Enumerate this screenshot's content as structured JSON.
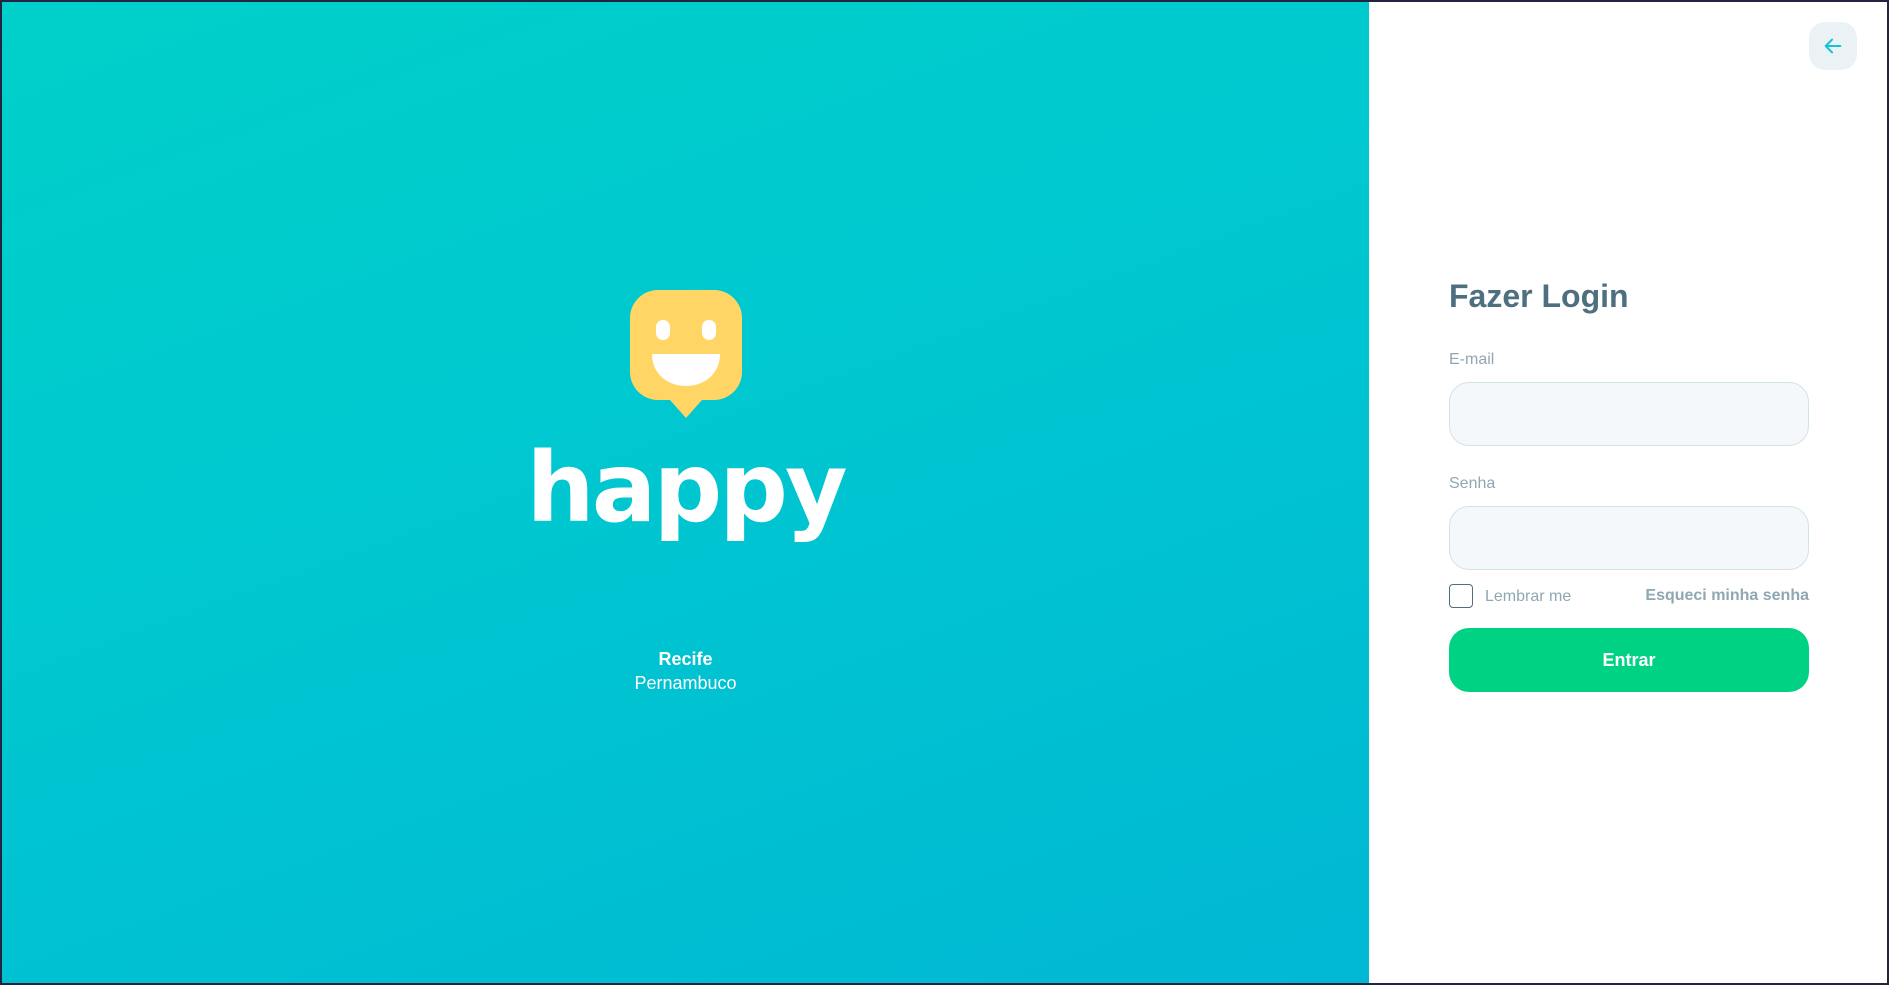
{
  "brand": {
    "wordmark": "happy",
    "logo_icon": "smiley-chat-bubble-icon",
    "city": "Recife",
    "state": "Pernambuco"
  },
  "login": {
    "title": "Fazer Login",
    "email_label": "E-mail",
    "email_value": "",
    "password_label": "Senha",
    "password_value": "",
    "remember_label": "Lembrar me",
    "remember_checked": false,
    "forgot_label": "Esqueci minha senha",
    "submit_label": "Entrar",
    "back_icon": "arrow-left-icon"
  },
  "colors": {
    "brand_gradient_start": "#00d0c9",
    "brand_gradient_end": "#00b8d4",
    "logo_yellow": "#ffd666",
    "title": "#4d6f80",
    "label": "#8fa7b2",
    "input_background": "#f5f8fa",
    "input_border": "#d3e2e5",
    "submit_button": "#00d283",
    "back_button_background": "#ebf2f5",
    "back_arrow": "#15c3d6"
  }
}
